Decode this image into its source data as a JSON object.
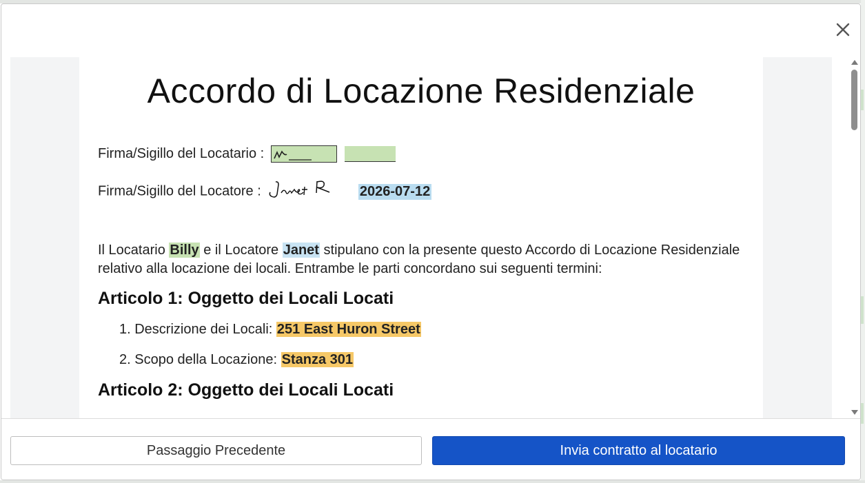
{
  "modal": {
    "close_icon": "close-icon",
    "document": {
      "title": "Accordo di Locazione Residenziale",
      "tenant_signature_label": "Firma/Sigillo del Locatario :",
      "landlord_signature_label": "Firma/Sigillo del Locatore :",
      "landlord_signature_text": "Janet R",
      "landlord_signature_date": "2026-07-12",
      "intro": {
        "part1": "Il Locatario ",
        "tenant_name": "Billy",
        "part2": " e il Locatore ",
        "landlord_name": "Janet",
        "part3": " stipulano con la presente questo Accordo di Locazione Residenziale relativo alla locazione dei locali. Entrambe le parti concordano sui seguenti termini:"
      },
      "article1": {
        "heading": "Articolo 1: Oggetto dei Locali Locati",
        "items": [
          {
            "label": "1. Descrizione dei Locali: ",
            "value": "251 East Huron Street"
          },
          {
            "label": "2. Scopo della Locazione: ",
            "value": "Stanza 301"
          }
        ]
      },
      "article2": {
        "heading": "Articolo 2: Oggetto dei Locali Locati"
      }
    },
    "footer": {
      "prev_button": "Passaggio Precedente",
      "send_button": "Invia contratto al locatario"
    }
  },
  "colors": {
    "primary_button": "#1554c7",
    "highlight_green": "#c7e2b3",
    "highlight_blue": "#c8e3f3",
    "highlight_orange": "#f6c867"
  }
}
